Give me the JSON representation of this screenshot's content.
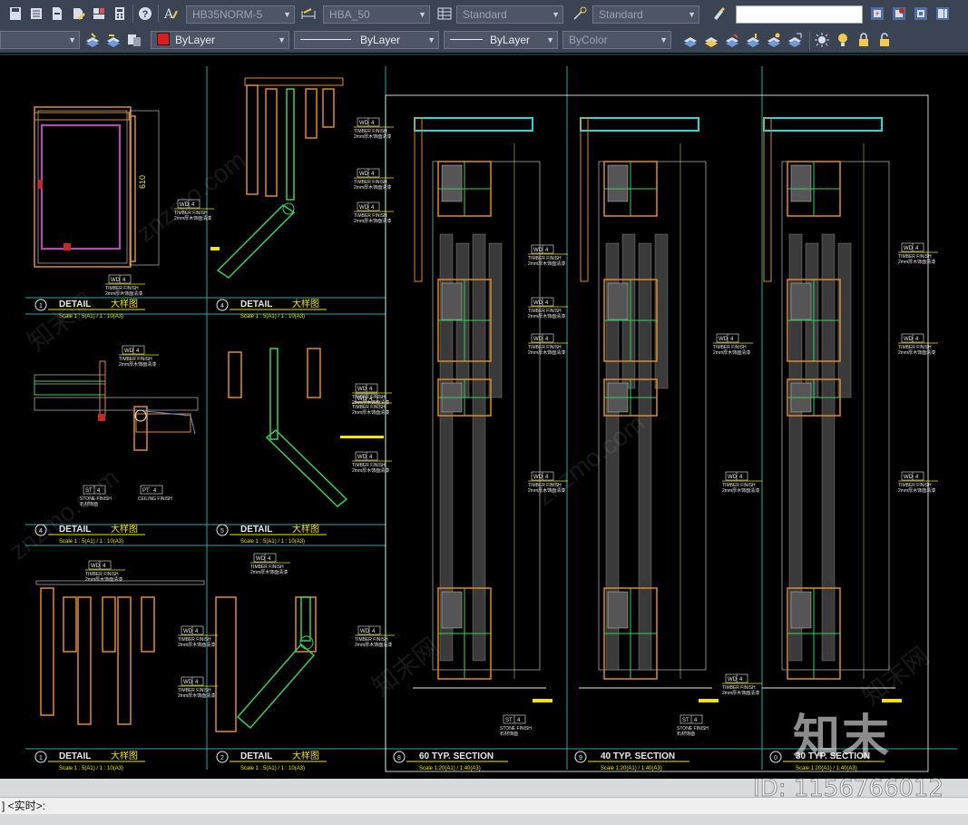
{
  "toolbar1": {
    "text_style": "HB35NORM-5",
    "dim_style": "HBA_50",
    "table_style": "Standard",
    "multileader_style": "Standard",
    "search_value": ""
  },
  "toolbar2": {
    "layer": "",
    "color": "ByLayer",
    "color_swatch": "#e01b1b",
    "linetype": "ByLayer",
    "lineweight": "ByLayer",
    "plotstyle": "ByColor"
  },
  "details": [
    {
      "num": "1",
      "title": "DETAIL",
      "cn": "大样图",
      "scale": "Scale 1 : 5(A1) / 1 : 10(A3)"
    },
    {
      "num": "4",
      "title": "DETAIL",
      "cn": "大样图",
      "scale": "Scale 1 : 5(A1) / 1 : 10(A3)"
    },
    {
      "num": "4",
      "title": "DETAIL",
      "cn": "大样图",
      "scale": "Scale 1 : 5(A1) / 1 : 10(A3)"
    },
    {
      "num": "5",
      "title": "DETAIL",
      "cn": "大样图",
      "scale": "Scale 1 : 5(A1) / 1 : 10(A3)"
    },
    {
      "num": "1",
      "title": "DETAIL",
      "cn": "大样图",
      "scale": "Scale 1 : 5(A1) / 1 : 10(A3)"
    },
    {
      "num": "2",
      "title": "DETAIL",
      "cn": "大样图",
      "scale": "Scale 1 : 5(A1) / 1 : 10(A3)"
    }
  ],
  "sections": [
    {
      "num": "8",
      "title": "60 TYP. SECTION",
      "scale": "Scale 1:20(A1) / 1:40(A3)"
    },
    {
      "num": "9",
      "title": "40 TYP. SECTION",
      "scale": "Scale 1:20(A1) / 1:40(A3)"
    },
    {
      "num": "0",
      "title": "30 TYP. SECTION",
      "scale": "Scale 1:20(A1) / 1:40(A3)"
    }
  ],
  "tags": {
    "wd": "WD",
    "four": "4",
    "timber": "TIMBER FINISH",
    "timber_cn": "2mm厚木饰面清漆",
    "st": "ST",
    "stone": "STONE FINISH",
    "stone_cn": "石材饰面",
    "pt": "PT",
    "ceiling": "CEILING FINISH",
    "dim_610": "610"
  },
  "command": {
    "prompt": "] <实时>:"
  },
  "watermark": {
    "logo": "知末",
    "id": "ID: 1156766012",
    "site": "znzmo.com",
    "cn": "知末网"
  }
}
